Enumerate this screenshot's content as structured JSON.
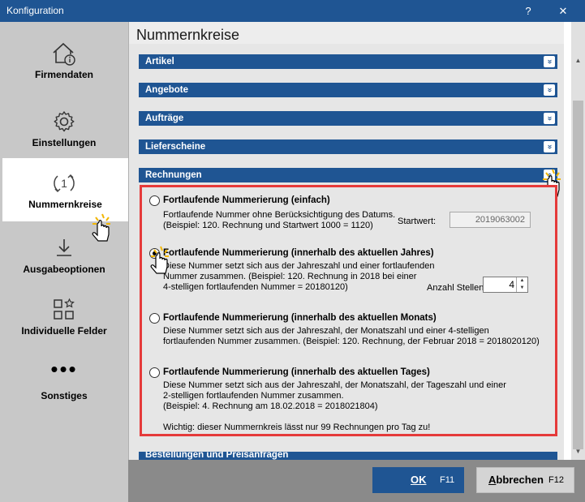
{
  "window": {
    "title": "Konfiguration",
    "help_label": "?",
    "close_label": "✕"
  },
  "sidebar": {
    "items": [
      {
        "label": "Firmendaten",
        "icon": "house-info-icon"
      },
      {
        "label": "Einstellungen",
        "icon": "gear-icon"
      },
      {
        "label": "Nummernkreise",
        "icon": "number-cycle-icon",
        "active": true
      },
      {
        "label": "Ausgabeoptionen",
        "icon": "download-icon"
      },
      {
        "label": "Individuelle Felder",
        "icon": "grid-star-icon"
      },
      {
        "label": "Sonstiges",
        "icon": "more-dots-icon",
        "glyph": "•••"
      }
    ]
  },
  "main": {
    "title": "Nummernkreise",
    "sections": [
      {
        "label": "Artikel",
        "expanded": false
      },
      {
        "label": "Angebote",
        "expanded": false
      },
      {
        "label": "Aufträge",
        "expanded": false
      },
      {
        "label": "Lieferscheine",
        "expanded": false
      },
      {
        "label": "Rechnungen",
        "expanded": true
      },
      {
        "label": "Bestellungen und Preisanfragen",
        "expanded": false
      }
    ],
    "chevron_down": "»",
    "chevron_up": "«",
    "rechnungen": {
      "options": [
        {
          "title": "Fortlaufende Nummerierung (einfach)",
          "desc": "Fortlaufende Nummer ohne Berücksichtigung des Datums.\n(Beispiel: 120. Rechnung und Startwert 1000 = 1120)",
          "checked": false
        },
        {
          "title": "Fortlaufende Nummerierung (innerhalb des aktuellen Jahres)",
          "desc": "Diese Nummer setzt sich aus der Jahreszahl und einer fortlaufenden\nNummer zusammen. (Beispiel: 120. Rechnung in 2018 bei einer\n4-stelligen fortlaufenden Nummer = 20180120)",
          "checked": true
        },
        {
          "title": "Fortlaufende Nummerierung (innerhalb des aktuellen Monats)",
          "desc": "Diese Nummer setzt sich aus der Jahreszahl, der Monatszahl und einer 4-stelligen\nfortlaufenden Nummer zusammen. (Beispiel: 120. Rechnung, der Februar 2018 = 2018020120)",
          "checked": false
        },
        {
          "title": "Fortlaufende Nummerierung (innerhalb des aktuellen Tages)",
          "desc": "Diese Nummer setzt sich aus der Jahreszahl, der Monatszahl, der Tageszahl und einer\n2-stelligen fortlaufenden Nummer zusammen.\n(Beispiel: 4. Rechnung am 18.02.2018 = 2018021804)",
          "checked": false
        }
      ],
      "startwert_label": "Startwert:",
      "startwert_value": "2019063002",
      "anzahl_label": "Anzahl Stellen:",
      "anzahl_value": "4",
      "warning": "Wichtig: dieser Nummernkreis lässt nur 99 Rechnungen pro Tag zu!"
    }
  },
  "footer": {
    "ok_label": "OK",
    "ok_key": "F11",
    "cancel_label_first": "A",
    "cancel_label_rest": "bbrechen",
    "cancel_key": "F12"
  },
  "colors": {
    "accent": "#1f5593",
    "highlight_border": "#e53a3a"
  }
}
